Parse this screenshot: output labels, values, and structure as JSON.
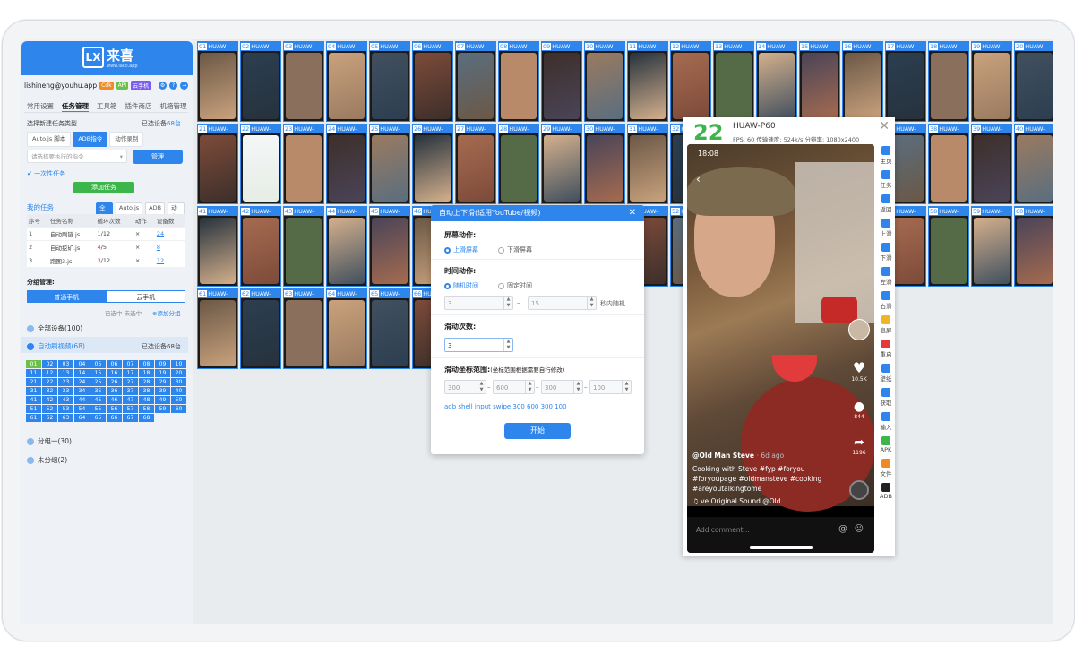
{
  "sidebar": {
    "logo_text": "来喜",
    "logo_sub": "www.laixi.app",
    "email": "lishineng@youhu.app",
    "badges": [
      "Cdk",
      "API",
      "云手机"
    ],
    "tabs": [
      "常用设置",
      "任务管理",
      "工具箱",
      "插件商店",
      "机箱管理"
    ],
    "task_type_label": "选择新建任务类型",
    "selected_devices": "已选设备",
    "selected_count": "68台",
    "task_types": [
      "Auto.js 脚本",
      "ADB指令",
      "动作录制"
    ],
    "select_placeholder": "请选择要执行的指令",
    "manage_label": "管理",
    "once_label": "一次性任务",
    "add_task_label": "添加任务",
    "my_tasks_label": "我的任务",
    "my_task_filters": [
      "全部",
      "Auto.js",
      "ADB",
      "动作"
    ],
    "table_headers": [
      "序号",
      "任务名称",
      "循环次数",
      "动作",
      "设备数"
    ],
    "tasks": [
      {
        "no": "1",
        "name": "自动刷链.js",
        "loop_a": "1",
        "loop_b": "/12",
        "action": "×",
        "devices": "24"
      },
      {
        "no": "2",
        "name": "自动挖矿.js",
        "loop_a": "4",
        "loop_b": "/5",
        "action": "×",
        "devices": "8"
      },
      {
        "no": "3",
        "name": "跑图3.js",
        "loop_a": "3",
        "loop_b": "/12",
        "action": "×",
        "devices": "12"
      }
    ],
    "group_label": "分组管理:",
    "group_tabs": [
      "普通手机",
      "云手机"
    ],
    "group_actions": "已选中  未选中",
    "add_group": "添加分组",
    "group_all": "全部设备(100)",
    "group_auto": "自动刷视频(68)",
    "group_auto_selected": "已选设备68台",
    "group_one": "分组一(30)",
    "group_none": "未分组(2)",
    "numbers": [
      "01",
      "02",
      "03",
      "04",
      "05",
      "06",
      "07",
      "08",
      "09",
      "10",
      "11",
      "12",
      "13",
      "14",
      "15",
      "16",
      "17",
      "18",
      "19",
      "20",
      "21",
      "22",
      "23",
      "24",
      "25",
      "26",
      "27",
      "28",
      "29",
      "30",
      "31",
      "32",
      "33",
      "34",
      "35",
      "36",
      "37",
      "38",
      "39",
      "40",
      "41",
      "42",
      "43",
      "44",
      "45",
      "46",
      "47",
      "48",
      "49",
      "50",
      "51",
      "52",
      "53",
      "54",
      "55",
      "56",
      "57",
      "58",
      "59",
      "60",
      "61",
      "62",
      "63",
      "64",
      "65",
      "66",
      "67",
      "68"
    ]
  },
  "device_label": "HUAW-",
  "device_numbers": [
    "01",
    "02",
    "03",
    "04",
    "05",
    "06",
    "07",
    "08",
    "09",
    "10",
    "11",
    "12",
    "13",
    "14",
    "15",
    "16",
    "17",
    "18",
    "19",
    "20",
    "21",
    "22",
    "23",
    "24",
    "25",
    "26",
    "27",
    "28",
    "29",
    "30",
    "31",
    "32",
    "33",
    "34",
    "35",
    "36",
    "37",
    "38",
    "39",
    "40",
    "41",
    "42",
    "43",
    "44",
    "45",
    "46",
    "47",
    "48",
    "49",
    "50",
    "51",
    "52",
    "53",
    "54",
    "55",
    "56",
    "57",
    "58",
    "59",
    "60",
    "61",
    "62",
    "63",
    "64",
    "65",
    "66"
  ],
  "dialog": {
    "title": "自动上下滑(适用YouTube/视频)",
    "screen_action": "屏幕动作:",
    "swipe_up": "上滑屏幕",
    "swipe_down": "下滑屏幕",
    "time_action": "时间动作:",
    "random_time": "随机时间",
    "fixed_time": "固定时间",
    "t_from": "3",
    "t_to": "15",
    "t_suffix": "秒内随机",
    "swipe_count_label": "滑动次数:",
    "swipe_count": "3",
    "range_label": "滑动坐标范围:",
    "range_note": "(坐标范围根据需要自行修改)",
    "coords": [
      "300",
      "600",
      "300",
      "100"
    ],
    "cmd": "adb shell input swipe 300 600 300 100",
    "start_label": "开始"
  },
  "phone": {
    "number": "22",
    "name": "HUAW-P60",
    "stats": "FPS: 60    传输速度: 524k/s  分辨率: 1080x2400",
    "time": "18:08",
    "likes": "10.5K",
    "comments": "844",
    "shares": "1196",
    "author": "@Old Man Steve",
    "ago": "· 6d ago",
    "caption1": "Cooking with Steve #fyp #foryou",
    "caption2": "#foryoupage #oldmansteve #cooking",
    "caption3": "#areyoutalkingtome",
    "sound": "♫  ve Original Sound    @Old",
    "add_comment": "Add comment...",
    "tools": [
      "主页",
      "任务",
      "返回",
      "上滑",
      "下滑",
      "左滑",
      "右滑",
      "息屏",
      "重启",
      "壁纸",
      "获取",
      "输入",
      "APK",
      "文件",
      "ADB"
    ]
  },
  "colors": {
    "accent": "#2e86ec",
    "green": "#3cb54a",
    "red": "#e23b3b"
  }
}
